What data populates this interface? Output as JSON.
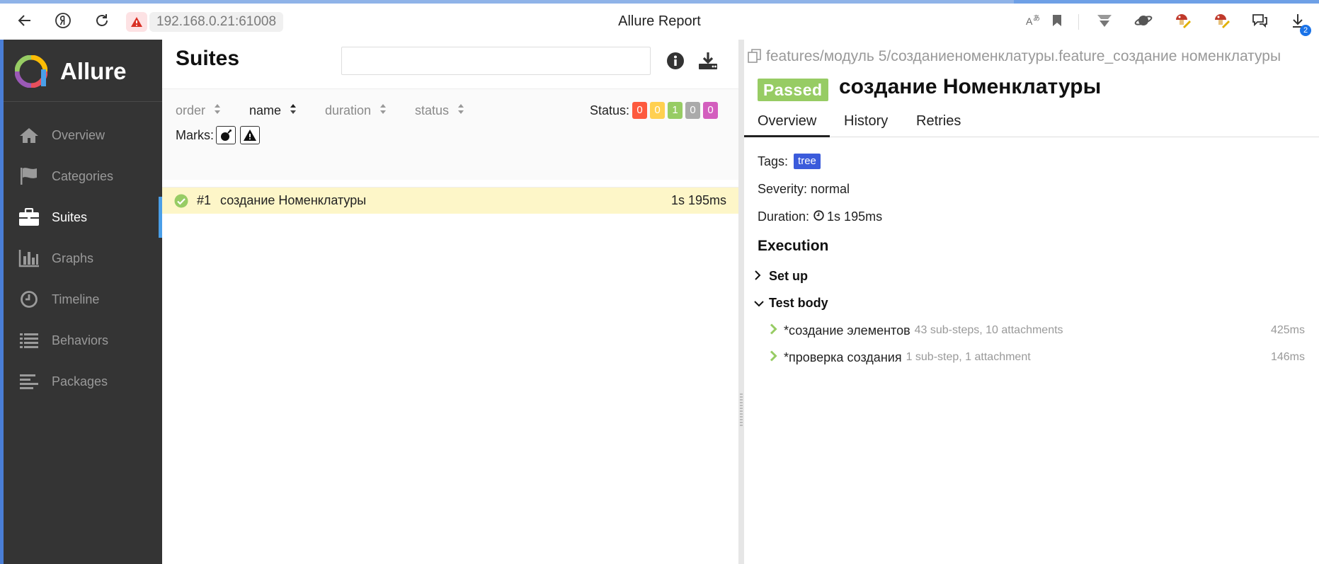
{
  "browser": {
    "url": "192.168.0.21:61008",
    "title": "Allure Report",
    "downloads_count": "2"
  },
  "sidebar": {
    "brand": "Allure",
    "items": [
      {
        "label": "Overview"
      },
      {
        "label": "Categories"
      },
      {
        "label": "Suites"
      },
      {
        "label": "Graphs"
      },
      {
        "label": "Timeline"
      },
      {
        "label": "Behaviors"
      },
      {
        "label": "Packages"
      }
    ],
    "active": "Suites"
  },
  "suites": {
    "title": "Suites",
    "search_value": "",
    "sort": {
      "order": "order",
      "name": "name",
      "duration": "duration",
      "status": "status",
      "active": "name"
    },
    "status_label": "Status:",
    "status_counts": [
      {
        "value": "0",
        "color": "#fd5a3e"
      },
      {
        "value": "0",
        "color": "#ffd050"
      },
      {
        "value": "1",
        "color": "#97cc64"
      },
      {
        "value": "0",
        "color": "#aaaaaa"
      },
      {
        "value": "0",
        "color": "#d35ebe"
      }
    ],
    "marks_label": "Marks:",
    "rows": [
      {
        "num": "#1",
        "name": "создание Номенклатуры",
        "duration": "1s 195ms",
        "status": "passed"
      }
    ]
  },
  "test": {
    "breadcrumb": "features/модуль 5/созданиеноменклатуры.feature_создание номенклатуры",
    "status_label": "Passed",
    "title": "создание Номенклатуры",
    "tabs": [
      {
        "label": "Overview"
      },
      {
        "label": "History"
      },
      {
        "label": "Retries"
      }
    ],
    "tags_label": "Tags:",
    "tag": "tree",
    "severity": "Severity: normal",
    "duration_label": "Duration:",
    "duration": "1s 195ms",
    "execution_label": "Execution",
    "setup_label": "Set up",
    "testbody_label": "Test body",
    "steps": [
      {
        "name": "*создание элементов",
        "meta": "43 sub-steps, 10 attachments",
        "duration": "425ms"
      },
      {
        "name": "*проверка создания",
        "meta": "1 sub-step, 1 attachment",
        "duration": "146ms"
      }
    ]
  },
  "colors": {
    "sidebar_bg": "#343434",
    "active_accent": "#4a9fe8",
    "passed": "#97cc64",
    "row_highlight": "#fdf6c8",
    "tag_bg": "#3b5bdb"
  }
}
